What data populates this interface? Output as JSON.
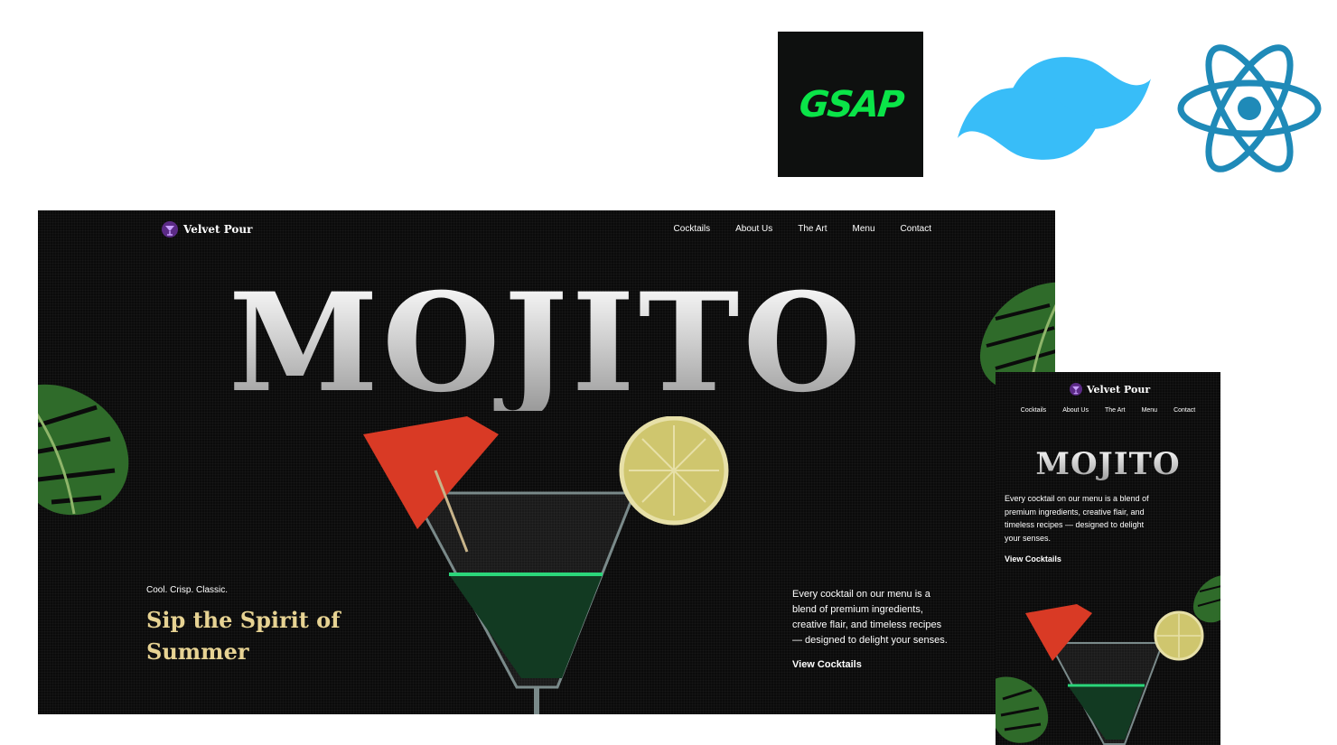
{
  "logos": {
    "gsap": "GSAP",
    "tailwind_icon": "tailwind-icon",
    "react_icon": "react-icon"
  },
  "desktop": {
    "brand": "Velvet Pour",
    "nav": [
      "Cocktails",
      "About Us",
      "The Art",
      "Menu",
      "Contact"
    ],
    "hero_title": "MOJITO",
    "tagline_small": "Cool. Crisp. Classic.",
    "tagline_big": "Sip the Spirit of Summer",
    "description": "Every cocktail on our menu is a blend of premium ingredients, creative flair, and timeless recipes — designed to delight your senses.",
    "cta": "View Cocktails"
  },
  "mobile": {
    "brand": "Velvet Pour",
    "nav": [
      "Cocktails",
      "About Us",
      "The Art",
      "Menu",
      "Contact"
    ],
    "hero_title": "MOJITO",
    "description": "Every cocktail on our menu is a blend of premium ingredients, creative flair, and timeless recipes — designed to delight your senses.",
    "cta": "View Cocktails"
  },
  "colors": {
    "background": "#0b0b0b",
    "accent_gold": "#e7d393",
    "gsap_green": "#0ae448",
    "tailwind_blue": "#38bdf8",
    "react_blue": "#1f8ab8"
  }
}
